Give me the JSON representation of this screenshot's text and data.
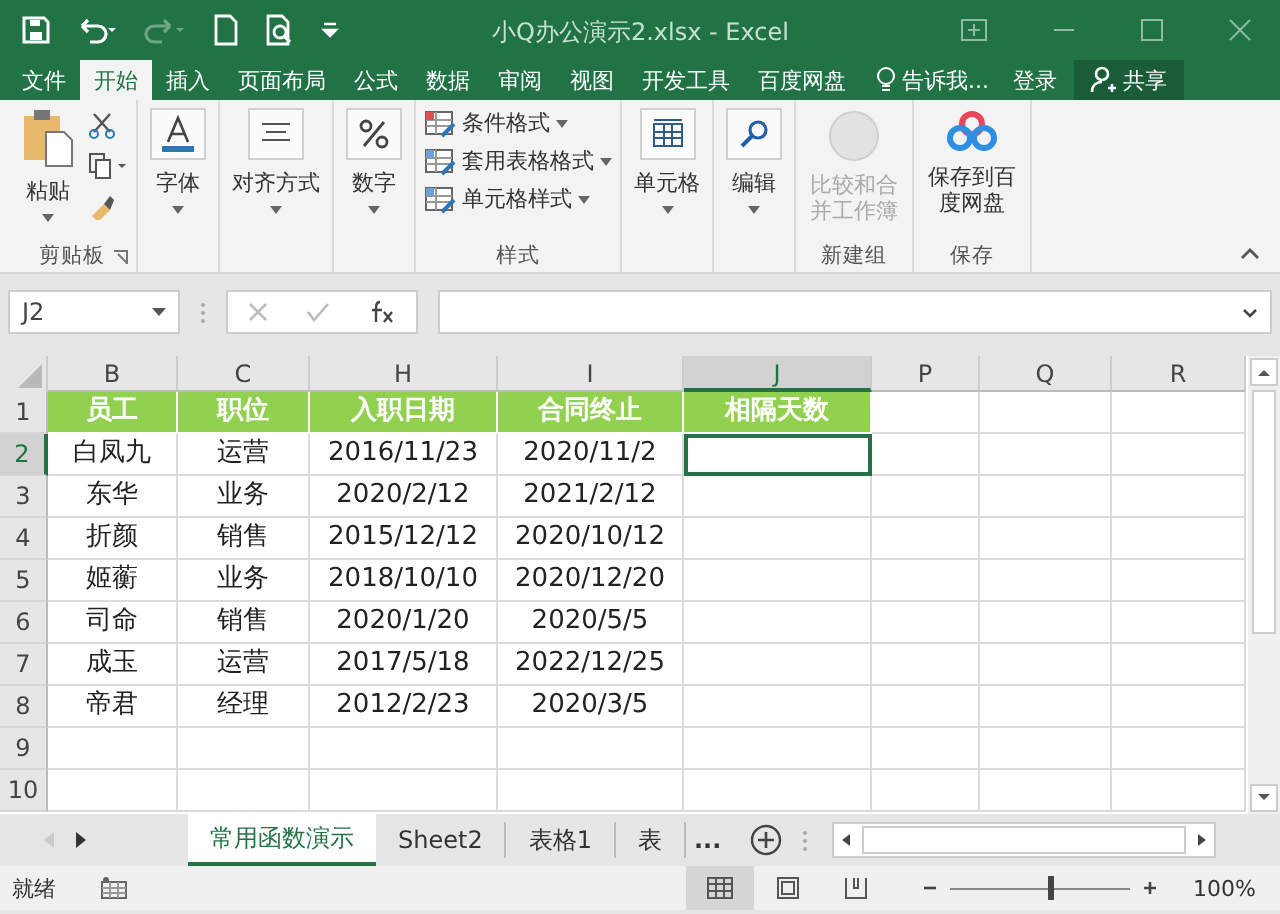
{
  "title_bar": {
    "title": "小Q办公演示2.xlsx - Excel"
  },
  "ribbon_tabs": [
    {
      "label": "文件",
      "selected": false
    },
    {
      "label": "开始",
      "selected": true
    },
    {
      "label": "插入",
      "selected": false
    },
    {
      "label": "页面布局",
      "selected": false
    },
    {
      "label": "公式",
      "selected": false
    },
    {
      "label": "数据",
      "selected": false
    },
    {
      "label": "审阅",
      "selected": false
    },
    {
      "label": "视图",
      "selected": false
    },
    {
      "label": "开发工具",
      "selected": false
    },
    {
      "label": "百度网盘",
      "selected": false
    }
  ],
  "tell_me": "告诉我...",
  "login": "登录",
  "share": "共享",
  "ribbon_groups": [
    {
      "kind": "clipboard",
      "label": "剪贴板",
      "buttons": [
        {
          "label": "粘贴"
        }
      ]
    },
    {
      "kind": "big",
      "buttons": [
        {
          "label": "字体"
        }
      ]
    },
    {
      "kind": "big",
      "buttons": [
        {
          "label": "对齐方式"
        }
      ]
    },
    {
      "kind": "big",
      "buttons": [
        {
          "label": "数字"
        }
      ]
    },
    {
      "kind": "styles",
      "label": "样式",
      "buttons": [
        {
          "label": "条件格式"
        },
        {
          "label": "套用表格格式"
        },
        {
          "label": "单元格样式"
        }
      ]
    },
    {
      "kind": "big",
      "buttons": [
        {
          "label": "单元格"
        }
      ]
    },
    {
      "kind": "big",
      "buttons": [
        {
          "label": "编辑"
        }
      ]
    },
    {
      "kind": "plain",
      "label": "新建组",
      "buttons": [
        {
          "label": "比较和合并工作簿",
          "disabled": true
        }
      ]
    },
    {
      "kind": "plain",
      "label": "保存",
      "buttons": [
        {
          "label": "保存到百度网盘",
          "disabled": false
        }
      ]
    }
  ],
  "formula_bar": {
    "name_box": "J2"
  },
  "columns": [
    {
      "label": "B",
      "selected": false
    },
    {
      "label": "C",
      "selected": false
    },
    {
      "label": "H",
      "selected": false
    },
    {
      "label": "I",
      "selected": false
    },
    {
      "label": "J",
      "selected": true
    },
    {
      "label": "P",
      "selected": false
    },
    {
      "label": "Q",
      "selected": false
    },
    {
      "label": "R",
      "selected": false
    }
  ],
  "rows": [
    {
      "number": "1",
      "selected": false,
      "header": true,
      "cells": [
        "员工",
        "职位",
        "入职日期",
        "合同终止",
        "相隔天数"
      ]
    },
    {
      "number": "2",
      "selected": true,
      "header": false,
      "cells": [
        "白凤九",
        "运营",
        "2016/11/23",
        "2020/11/2",
        ""
      ]
    },
    {
      "number": "3",
      "selected": false,
      "header": false,
      "cells": [
        "东华",
        "业务",
        "2020/2/12",
        "2021/2/12",
        ""
      ]
    },
    {
      "number": "4",
      "selected": false,
      "header": false,
      "cells": [
        "折颜",
        "销售",
        "2015/12/12",
        "2020/10/12",
        ""
      ]
    },
    {
      "number": "5",
      "selected": false,
      "header": false,
      "cells": [
        "姬蘅",
        "业务",
        "2018/10/10",
        "2020/12/20",
        ""
      ]
    },
    {
      "number": "6",
      "selected": false,
      "header": false,
      "cells": [
        "司命",
        "销售",
        "2020/1/20",
        "2020/5/5",
        ""
      ]
    },
    {
      "number": "7",
      "selected": false,
      "header": false,
      "cells": [
        "成玉",
        "运营",
        "2017/5/18",
        "2022/12/25",
        ""
      ]
    },
    {
      "number": "8",
      "selected": false,
      "header": false,
      "cells": [
        "帝君",
        "经理",
        "2012/2/23",
        "2020/3/5",
        ""
      ]
    },
    {
      "number": "9",
      "selected": false,
      "header": false,
      "cells": [
        "",
        "",
        "",
        "",
        ""
      ]
    },
    {
      "number": "10",
      "selected": false,
      "header": false,
      "cells": [
        "",
        "",
        "",
        "",
        ""
      ]
    }
  ],
  "sheet_tabs": [
    {
      "label": "常用函数演示",
      "selected": true
    },
    {
      "label": "Sheet2",
      "selected": false
    },
    {
      "label": "表格1",
      "selected": false
    },
    {
      "label": "表",
      "selected": false
    }
  ],
  "more_tabs": "...",
  "status_bar": {
    "status": "就绪",
    "zoom": "100%",
    "level": 0.55
  }
}
